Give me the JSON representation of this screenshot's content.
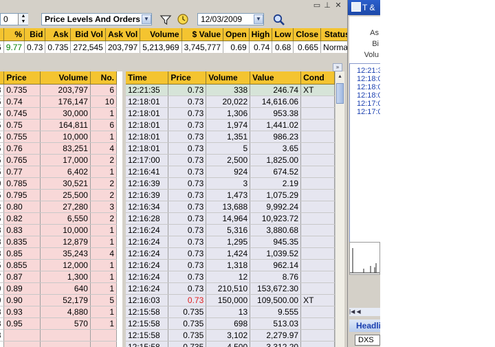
{
  "window": {
    "buttons": [
      "restore",
      "pin",
      "close"
    ]
  },
  "toolbar": {
    "spinner_value": "0",
    "view_select": "Price Levels And Orders",
    "date": "12/03/2009"
  },
  "quote": {
    "headers": [
      "%",
      "Bid",
      "Ask",
      "Bid Vol",
      "Ask Vol",
      "Volume",
      "$ Value",
      "Open",
      "High",
      "Low",
      "Close",
      "Status"
    ],
    "values": [
      "9.77",
      "0.73",
      "0.735",
      "272,545",
      "203,797",
      "5,213,969",
      "3,745,777",
      "0.69",
      "0.74",
      "0.68",
      "0.665",
      "Normal"
    ],
    "first_stub": "6"
  },
  "levels": {
    "headers": [
      "Price",
      "Volume",
      "No."
    ],
    "stubs": [
      "8",
      "5",
      "5",
      "5",
      "5",
      "5",
      "5",
      "5",
      "9",
      "5",
      "3",
      "5",
      "3",
      "3",
      "3",
      "5",
      "7",
      "9",
      "9",
      "3",
      "3",
      "3",
      "",
      ""
    ],
    "rows": [
      [
        "0.735",
        "203,797",
        "6"
      ],
      [
        "0.74",
        "176,147",
        "10"
      ],
      [
        "0.745",
        "30,000",
        "1"
      ],
      [
        "0.75",
        "164,811",
        "6"
      ],
      [
        "0.755",
        "10,000",
        "1"
      ],
      [
        "0.76",
        "83,251",
        "4"
      ],
      [
        "0.765",
        "17,000",
        "2"
      ],
      [
        "0.77",
        "6,402",
        "1"
      ],
      [
        "0.785",
        "30,521",
        "2"
      ],
      [
        "0.795",
        "25,500",
        "2"
      ],
      [
        "0.80",
        "27,280",
        "3"
      ],
      [
        "0.82",
        "6,550",
        "2"
      ],
      [
        "0.83",
        "10,000",
        "1"
      ],
      [
        "0.835",
        "12,879",
        "1"
      ],
      [
        "0.85",
        "35,243",
        "4"
      ],
      [
        "0.855",
        "12,000",
        "1"
      ],
      [
        "0.87",
        "1,300",
        "1"
      ],
      [
        "0.89",
        "640",
        "1"
      ],
      [
        "0.90",
        "52,179",
        "5"
      ],
      [
        "0.93",
        "4,880",
        "1"
      ],
      [
        "0.95",
        "570",
        "1"
      ],
      [
        "",
        "",
        ""
      ],
      [
        "",
        "",
        ""
      ]
    ]
  },
  "trades": {
    "headers": [
      "Time",
      "Price",
      "Volume",
      "Value",
      "Cond"
    ],
    "rows": [
      [
        "12:21:35",
        "0.73",
        "338",
        "246.74",
        "XT"
      ],
      [
        "12:18:01",
        "0.73",
        "20,022",
        "14,616.06",
        ""
      ],
      [
        "12:18:01",
        "0.73",
        "1,306",
        "953.38",
        ""
      ],
      [
        "12:18:01",
        "0.73",
        "1,974",
        "1,441.02",
        ""
      ],
      [
        "12:18:01",
        "0.73",
        "1,351",
        "986.23",
        ""
      ],
      [
        "12:18:01",
        "0.73",
        "5",
        "3.65",
        ""
      ],
      [
        "12:17:00",
        "0.73",
        "2,500",
        "1,825.00",
        ""
      ],
      [
        "12:16:41",
        "0.73",
        "924",
        "674.52",
        ""
      ],
      [
        "12:16:39",
        "0.73",
        "3",
        "2.19",
        ""
      ],
      [
        "12:16:39",
        "0.73",
        "1,473",
        "1,075.29",
        ""
      ],
      [
        "12:16:34",
        "0.73",
        "13,688",
        "9,992.24",
        ""
      ],
      [
        "12:16:28",
        "0.73",
        "14,964",
        "10,923.72",
        ""
      ],
      [
        "12:16:24",
        "0.73",
        "5,316",
        "3,880.68",
        ""
      ],
      [
        "12:16:24",
        "0.73",
        "1,295",
        "945.35",
        ""
      ],
      [
        "12:16:24",
        "0.73",
        "1,424",
        "1,039.52",
        ""
      ],
      [
        "12:16:24",
        "0.73",
        "1,318",
        "962.14",
        ""
      ],
      [
        "12:16:24",
        "0.73",
        "12",
        "8.76",
        ""
      ],
      [
        "12:16:24",
        "0.73",
        "210,510",
        "153,672.30",
        ""
      ],
      [
        "12:16:03",
        "0.73",
        "150,000",
        "109,500.00",
        "XT"
      ],
      [
        "12:15:58",
        "0.735",
        "13",
        "9.555",
        ""
      ],
      [
        "12:15:58",
        "0.735",
        "698",
        "513.03",
        ""
      ],
      [
        "12:15:58",
        "0.735",
        "3,102",
        "2,279.97",
        ""
      ],
      [
        "12:15:58",
        "0.735",
        "4,500",
        "3,312.20",
        ""
      ]
    ],
    "red_price_row": 18
  },
  "right_panel": {
    "title": "T &",
    "labels": [
      "As",
      "Bi",
      "Volu"
    ],
    "times": [
      "12:21:3",
      "12:18:0",
      "12:18:0",
      "12:18:0",
      "12:17:0",
      "12:17:0"
    ],
    "headline_tab": "Headlin",
    "symbol": "DXS"
  },
  "colors": {
    "header_gold": "#f4c430",
    "ask_row_pink": "#f8d8d8",
    "trade_row": "#e6e6f0",
    "highlight_row": "#d6e4d8",
    "uptick_green": "#008000",
    "price_red": "#e02020"
  }
}
